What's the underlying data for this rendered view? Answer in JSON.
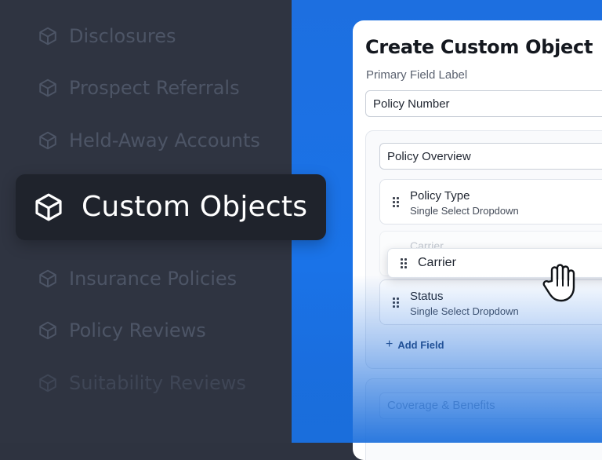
{
  "sidebar": {
    "items": [
      {
        "label": "Disclosures",
        "icon": "cube-icon"
      },
      {
        "label": "Prospect Referrals",
        "icon": "cube-icon"
      },
      {
        "label": "Held-Away Accounts",
        "icon": "cube-icon"
      },
      {
        "label": "Custom Objects",
        "icon": "cube-icon",
        "active": true
      },
      {
        "label": "Insurance Policies",
        "icon": "cube-icon"
      },
      {
        "label": "Policy Reviews",
        "icon": "cube-icon"
      },
      {
        "label": "Suitability Reviews",
        "icon": "cube-icon"
      }
    ]
  },
  "card": {
    "title": "Create Custom Object",
    "primary_field_label": "Primary Field Label",
    "primary_field_value": "Policy Number",
    "section": {
      "name": "Policy Overview",
      "fields": [
        {
          "title": "Policy Type",
          "type": "Single Select Dropdown"
        },
        {
          "title": "Status",
          "type": "Single Select Dropdown"
        }
      ],
      "ghost_field": "Carrier",
      "dragging_field": "Carrier",
      "add_field_label": "Add Field"
    },
    "next_section_name": "Coverage & Benefits"
  },
  "colors": {
    "sidebar_bg": "#2f3441",
    "highlight_bg": "#1f232c",
    "accent_blue": "#1a73e8",
    "link_color": "#24406e"
  }
}
